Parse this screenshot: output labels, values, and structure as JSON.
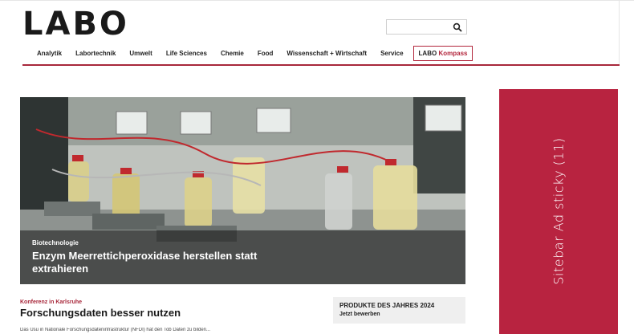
{
  "brand": {
    "logo_text": "LABO"
  },
  "search": {
    "placeholder": "",
    "icon": "search-icon"
  },
  "nav": {
    "items": [
      "Analytik",
      "Labortechnik",
      "Umwelt",
      "Life Sciences",
      "Chemie",
      "Food",
      "Wissenschaft + Wirtschaft",
      "Service"
    ],
    "kompass_prefix": "LABO",
    "kompass_accent": "Kompass"
  },
  "hero": {
    "kicker": "Biotechnologie",
    "headline": "Enzym Meerrettichperoxidase herstellen statt extrahieren"
  },
  "article2": {
    "kicker": "Konferenz in Karlsruhe",
    "title": "Forschungsdaten besser nutzen",
    "teaser": "Das Usu in Nationale Forschungsdateninfrastruktur (NFDI) hat den Tob Daten zu bilden..."
  },
  "promo": {
    "line1": "PRODUKTE DES JAHRES 2024",
    "line2": "Jetzt bewerben"
  },
  "sidebar_ad": {
    "text": "Sitebar Ad sticky (11)"
  },
  "colors": {
    "accent": "#b2253b",
    "ad_background": "#b82340",
    "promo_background": "#efefef"
  }
}
